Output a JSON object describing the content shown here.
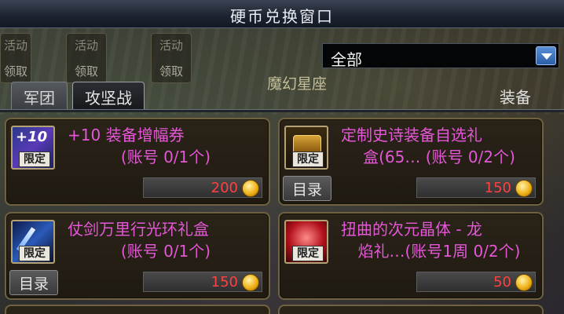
{
  "window": {
    "title": "硬币兑换窗口"
  },
  "background": {
    "claim_buttons": [
      {
        "top": "活动",
        "bottom": "领取"
      },
      {
        "top": "活动",
        "bottom": "领取"
      },
      {
        "top": "活动",
        "bottom": "领取"
      }
    ],
    "region_label": "魔幻星座",
    "equip_label": "装备"
  },
  "filter": {
    "selected": "全部"
  },
  "tabs": [
    {
      "label": "军团",
      "active": false
    },
    {
      "label": "攻坚战",
      "active": true
    }
  ],
  "items": [
    {
      "name_line1": "+10 装备增幅券",
      "name_line2": "(账号 0/1个)",
      "price": "200",
      "badge": "限定",
      "icon_text": "+10",
      "has_catalog": false
    },
    {
      "name_line1": "定制史诗装备自选礼",
      "name_line2": "盒(65… (账号 0/2个)",
      "price": "150",
      "badge": "限定",
      "has_catalog": true,
      "catalog_label": "目录"
    },
    {
      "name_line1": "仗剑万里行光环礼盒",
      "name_line2": "(账号 0/1个)",
      "price": "150",
      "badge": "限定",
      "has_catalog": true,
      "catalog_label": "目录"
    },
    {
      "name_line1": "扭曲的次元晶体 - 龙",
      "name_line2": "焰礼…(账号1周 0/2个)",
      "price": "50",
      "badge": "限定",
      "has_catalog": false
    }
  ],
  "colors": {
    "item_name": "#e457d6",
    "price": "#ff4040",
    "card_border": "#6f6240"
  }
}
